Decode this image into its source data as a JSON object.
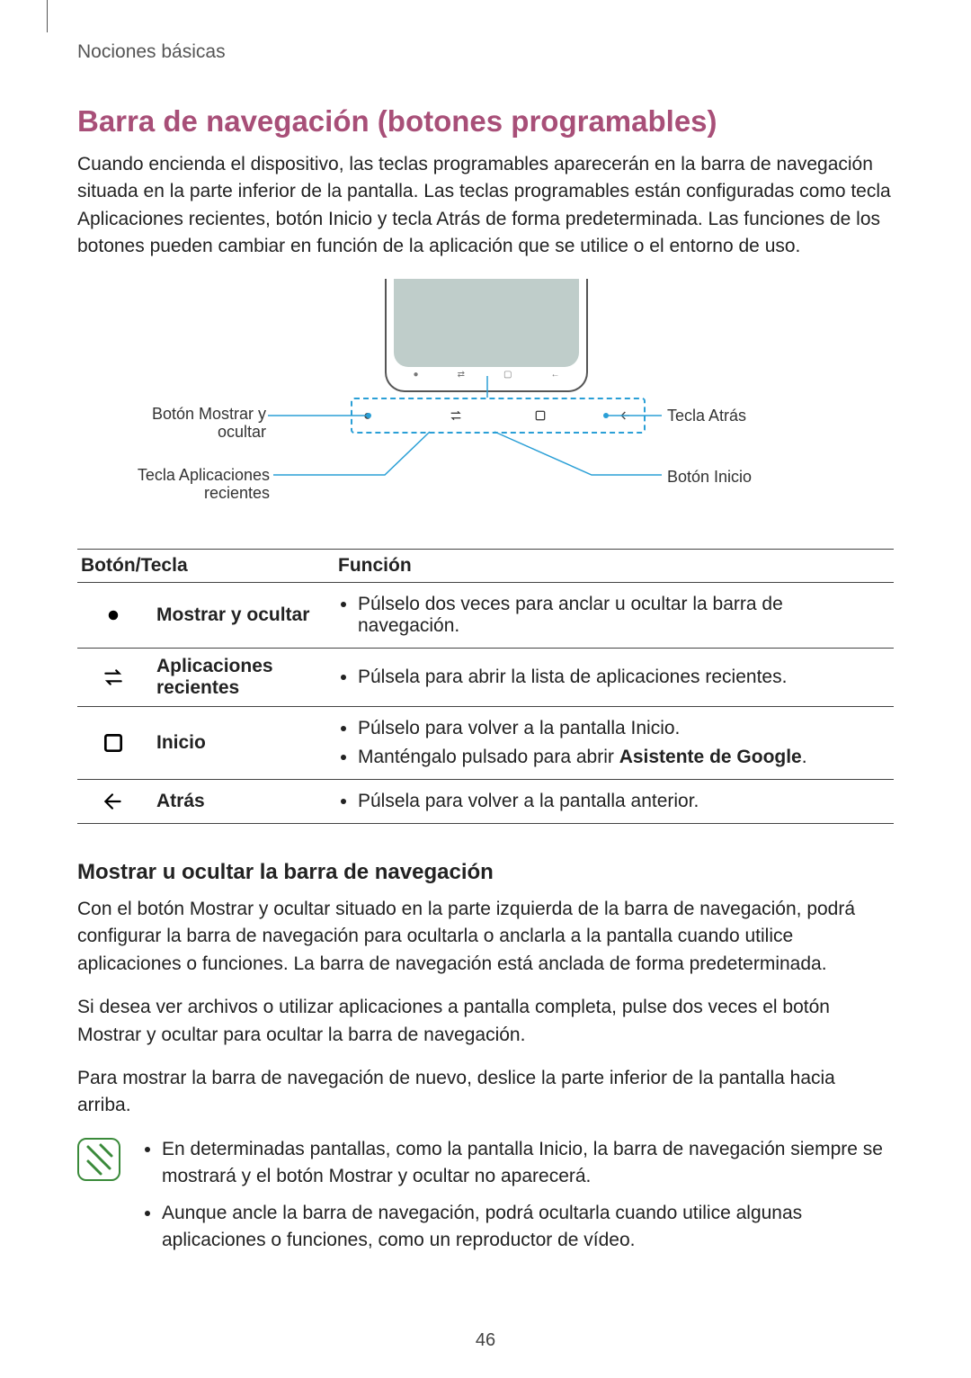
{
  "section_label": "Nociones básicas",
  "heading": "Barra de navegación (botones programables)",
  "intro": "Cuando encienda el dispositivo, las teclas programables aparecerán en la barra de navegación situada en la parte inferior de la pantalla. Las teclas programables están configuradas como tecla Aplicaciones recientes, botón Inicio y tecla Atrás de forma predeterminada. Las funciones de los botones pueden cambiar en función de la aplicación que se utilice o el entorno de uso.",
  "figure": {
    "label_show_hide": "Botón Mostrar y ocultar",
    "label_recents": "Tecla Aplicaciones recientes",
    "label_back": "Tecla Atrás",
    "label_home": "Botón Inicio"
  },
  "table": {
    "col1": "Botón/Tecla",
    "col2": "Función",
    "rows": [
      {
        "label": "Mostrar y ocultar",
        "funcs": [
          "Púlselo dos veces para anclar u ocultar la barra de navegación."
        ]
      },
      {
        "label": "Aplicaciones recientes",
        "funcs": [
          "Púlsela para abrir la lista de aplicaciones recientes."
        ]
      },
      {
        "label": "Inicio",
        "funcs": [
          "Púlselo para volver a la pantalla Inicio.",
          "Manténgalo pulsado para abrir Asistente de Google."
        ],
        "bold_phrase": "Asistente de Google"
      },
      {
        "label": "Atrás",
        "funcs": [
          "Púlsela para volver a la pantalla anterior."
        ]
      }
    ]
  },
  "subheading": "Mostrar u ocultar la barra de navegación",
  "p1": "Con el botón Mostrar y ocultar situado en la parte izquierda de la barra de navegación, podrá configurar la barra de navegación para ocultarla o anclarla a la pantalla cuando utilice aplicaciones o funciones. La barra de navegación está anclada de forma predeterminada.",
  "p2": "Si desea ver archivos o utilizar aplicaciones a pantalla completa, pulse dos veces el botón Mostrar y ocultar para ocultar la barra de navegación.",
  "p3": "Para mostrar la barra de navegación de nuevo, deslice la parte inferior de la pantalla hacia arriba.",
  "notes": [
    "En determinadas pantallas, como la pantalla Inicio, la barra de navegación siempre se mostrará y el botón Mostrar y ocultar no aparecerá.",
    "Aunque ancle la barra de navegación, podrá ocultarla cuando utilice algunas aplicaciones o funciones, como un reproductor de vídeo."
  ],
  "page_number": "46"
}
